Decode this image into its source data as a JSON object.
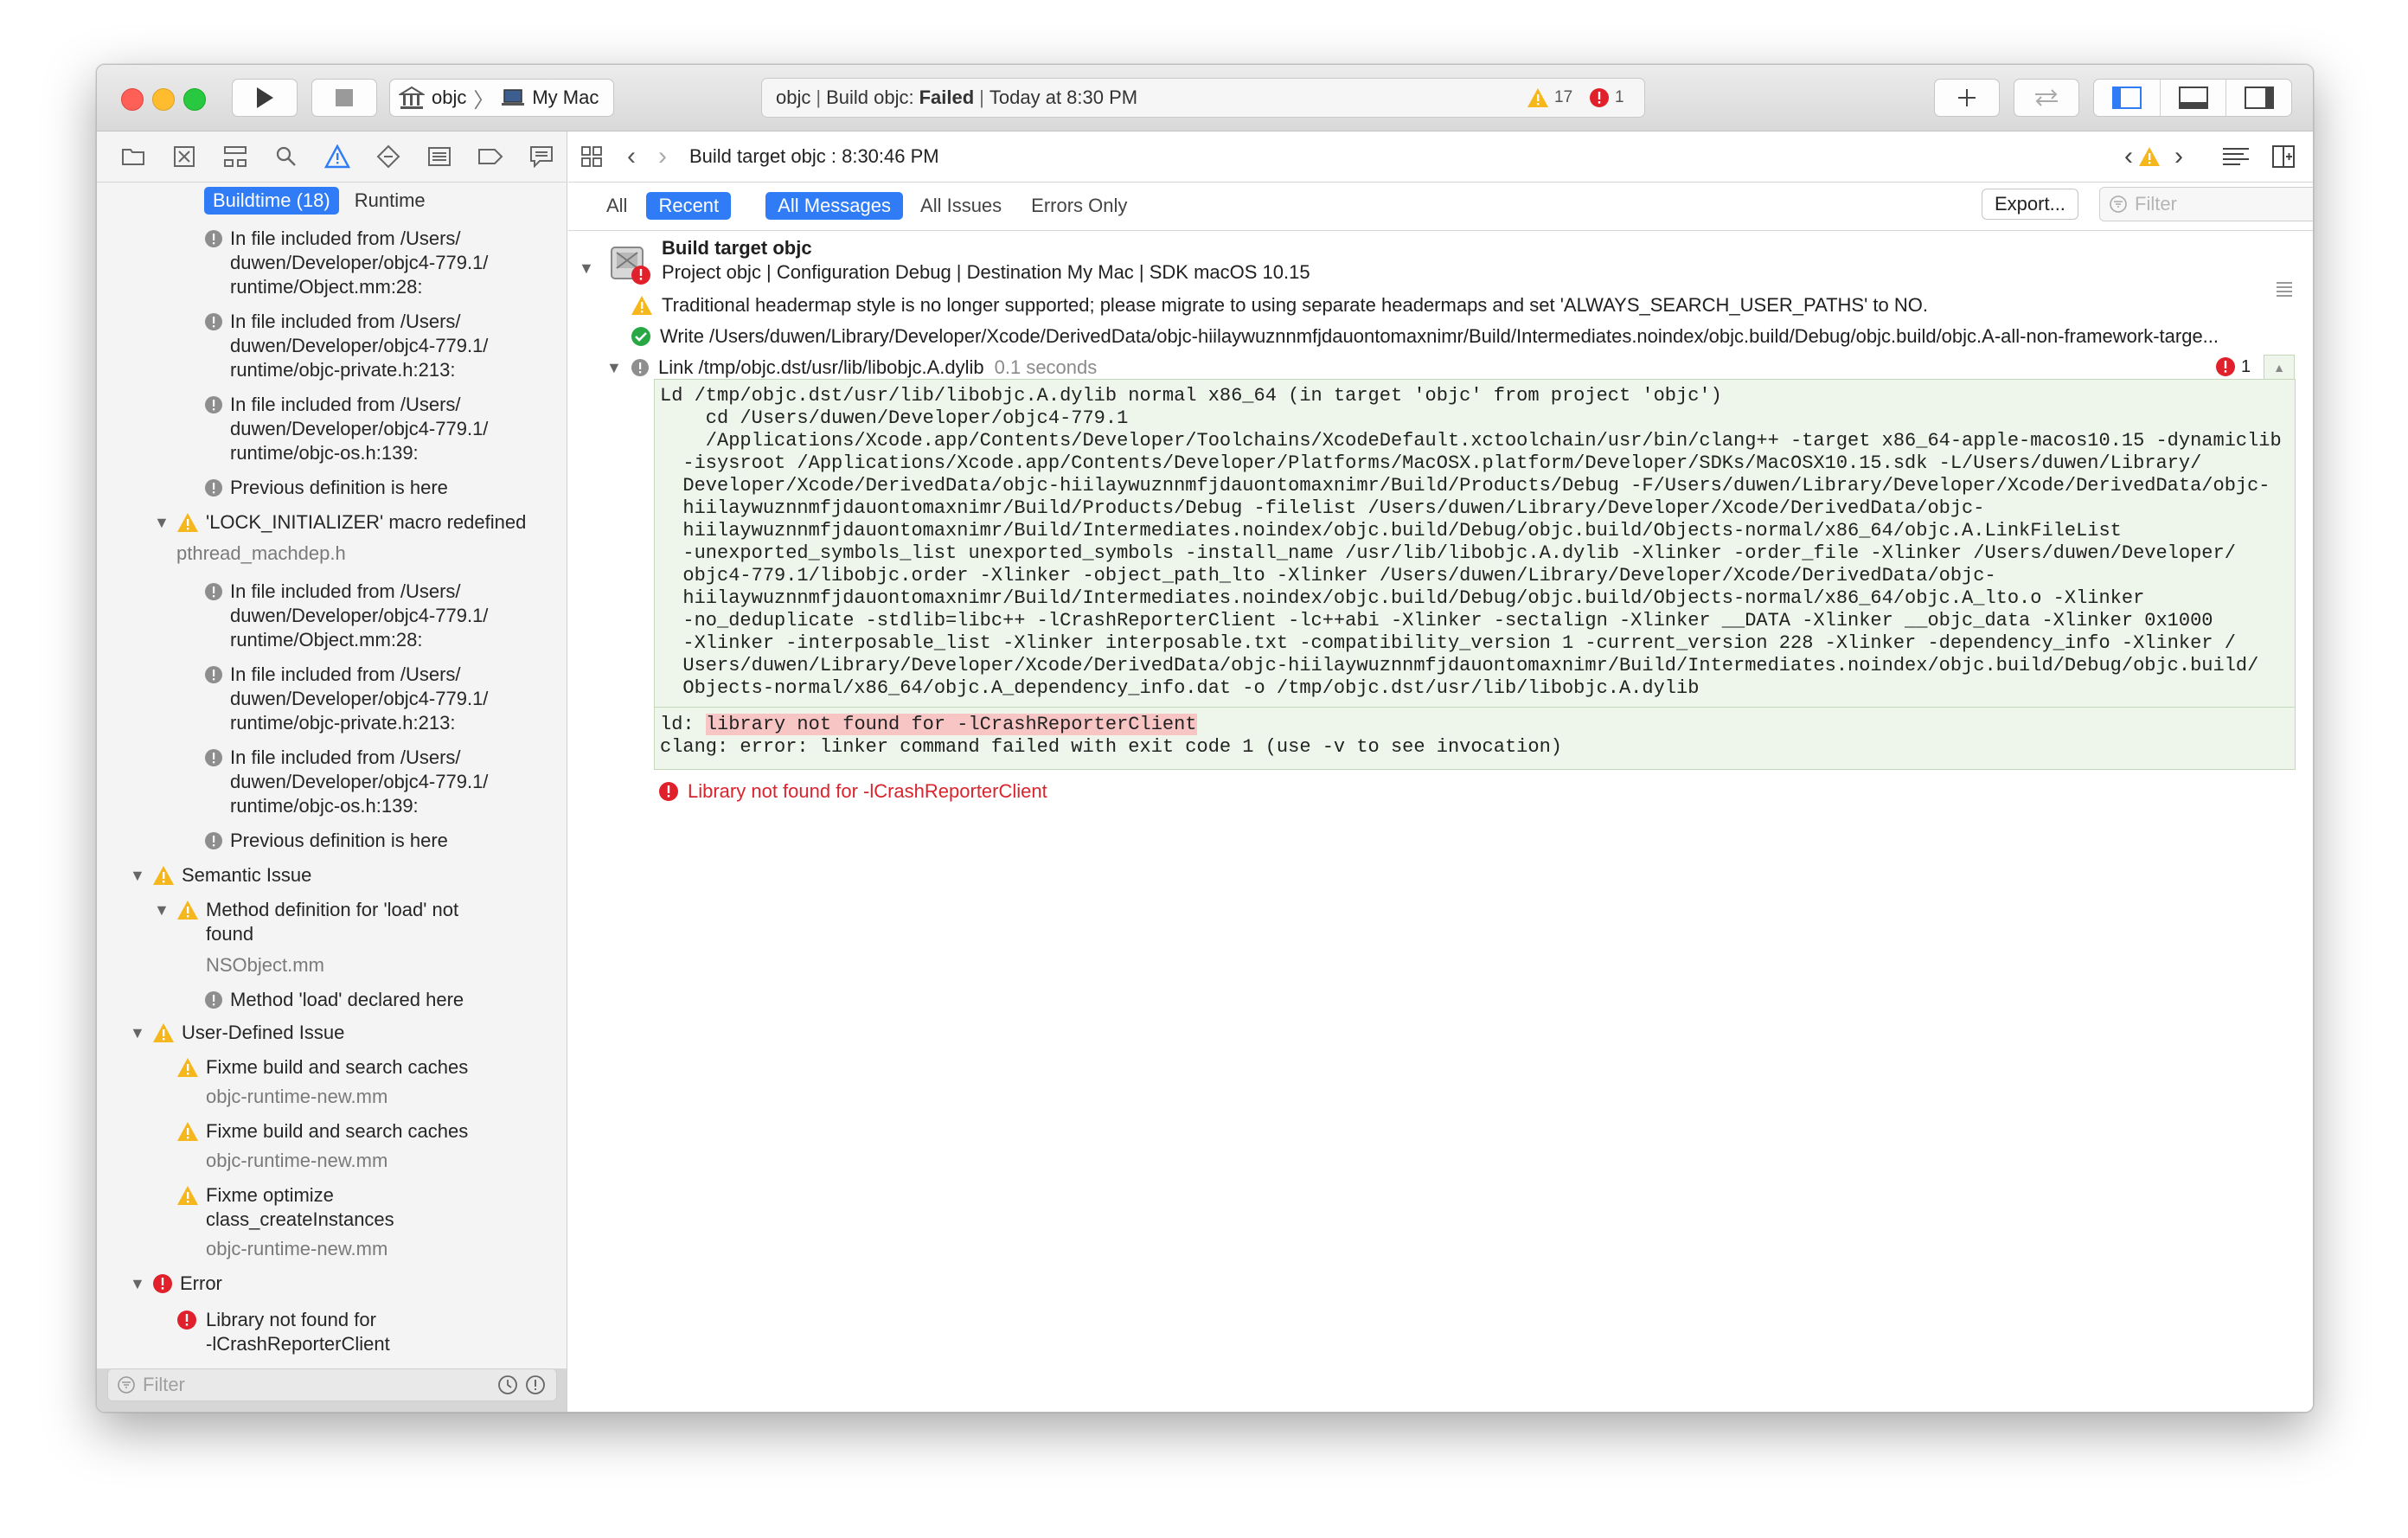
{
  "toolbar": {
    "scheme_name": "objc",
    "destination": "My Mac",
    "activity_project": "objc",
    "activity_action": "Build objc:",
    "activity_status": "Failed",
    "activity_time": "Today at 8:30 PM",
    "warning_count": "17",
    "error_count": "1",
    "colors": {
      "warning": "#f5b71b",
      "error": "#e0202b"
    }
  },
  "navigator": {
    "scope_tabs": [
      "Buildtime (18)",
      "Runtime"
    ],
    "rows": [
      {
        "type": "note",
        "text": "In file included from /Users/\nduwen/Developer/objc4-779.1/\nruntime/Object.mm:28:"
      },
      {
        "type": "note",
        "text": "In file included from /Users/\nduwen/Developer/objc4-779.1/\nruntime/objc-private.h:213:"
      },
      {
        "type": "note",
        "text": "In file included from /Users/\nduwen/Developer/objc4-779.1/\nruntime/objc-os.h:139:"
      },
      {
        "type": "note",
        "text": "Previous definition is here"
      },
      {
        "type": "warning",
        "text": "'LOCK_INITIALIZER' macro redefined",
        "sub": "pthread_machdep.h"
      },
      {
        "type": "note",
        "text": "In file included from /Users/\nduwen/Developer/objc4-779.1/\nruntime/Object.mm:28:"
      },
      {
        "type": "note",
        "text": "In file included from /Users/\nduwen/Developer/objc4-779.1/\nruntime/objc-private.h:213:"
      },
      {
        "type": "note",
        "text": "In file included from /Users/\nduwen/Developer/objc4-779.1/\nruntime/objc-os.h:139:"
      },
      {
        "type": "note",
        "text": "Previous definition is here"
      },
      {
        "type": "group-warning",
        "text": "Semantic Issue"
      },
      {
        "type": "warning",
        "text": "Method definition for 'load' not\nfound",
        "sub": "NSObject.mm"
      },
      {
        "type": "note",
        "text": "Method 'load' declared here"
      },
      {
        "type": "group-warning",
        "text": "User-Defined Issue"
      },
      {
        "type": "warning",
        "text": "Fixme build and search caches",
        "sub": "objc-runtime-new.mm"
      },
      {
        "type": "warning",
        "text": "Fixme build and search caches",
        "sub": "objc-runtime-new.mm"
      },
      {
        "type": "warning",
        "text": "Fixme optimize\nclass_createInstances",
        "sub": "objc-runtime-new.mm"
      },
      {
        "type": "group-error",
        "text": "Error"
      },
      {
        "type": "error",
        "text": "Library not found for\n-lCrashReporterClient"
      }
    ],
    "filter_placeholder": "Filter"
  },
  "editor": {
    "jump_title": "Build target objc : 8:30:46 PM",
    "filters": [
      "All",
      "Recent",
      "All Messages",
      "All Issues",
      "Errors Only"
    ],
    "export_label": "Export...",
    "filter_placeholder": "Filter",
    "target_title": "Build target objc",
    "target_meta": "Project objc | Configuration Debug | Destination My Mac | SDK macOS 10.15",
    "warning_line": "Traditional headermap style is no longer supported; please migrate to using separate headermaps and set 'ALWAYS_SEARCH_USER_PATHS' to NO.",
    "write_line": "Write /Users/duwen/Library/Developer/Xcode/DerivedData/objc-hiilaywuznnmfjdauontomaxnimr/Build/Intermediates.noindex/objc.build/Debug/objc.build/objc.A-all-non-framework-targe...",
    "link_line": "Link /tmp/objc.dst/usr/lib/libobjc.A.dylib",
    "link_duration": "0.1 seconds",
    "link_error_count": "1",
    "command_lines": [
      "Ld /tmp/objc.dst/usr/lib/libobjc.A.dylib normal x86_64 (in target 'objc' from project 'objc')",
      "    cd /Users/duwen/Developer/objc4-779.1",
      "    /Applications/Xcode.app/Contents/Developer/Toolchains/XcodeDefault.xctoolchain/usr/bin/clang++ -target x86_64-apple-macos10.15 -dynamiclib",
      "  -isysroot /Applications/Xcode.app/Contents/Developer/Platforms/MacOSX.platform/Developer/SDKs/MacOSX10.15.sdk -L/Users/duwen/Library/",
      "  Developer/Xcode/DerivedData/objc-hiilaywuznnmfjdauontomaxnimr/Build/Products/Debug -F/Users/duwen/Library/Developer/Xcode/DerivedData/objc-",
      "  hiilaywuznnmfjdauontomaxnimr/Build/Products/Debug -filelist /Users/duwen/Library/Developer/Xcode/DerivedData/objc-",
      "  hiilaywuznnmfjdauontomaxnimr/Build/Intermediates.noindex/objc.build/Debug/objc.build/Objects-normal/x86_64/objc.A.LinkFileList",
      "  -unexported_symbols_list unexported_symbols -install_name /usr/lib/libobjc.A.dylib -Xlinker -order_file -Xlinker /Users/duwen/Developer/",
      "  objc4-779.1/libobjc.order -Xlinker -object_path_lto -Xlinker /Users/duwen/Library/Developer/Xcode/DerivedData/objc-",
      "  hiilaywuznnmfjdauontomaxnimr/Build/Intermediates.noindex/objc.build/Debug/objc.build/Objects-normal/x86_64/objc.A_lto.o -Xlinker",
      "  -no_deduplicate -stdlib=libc++ -lCrashReporterClient -lc++abi -Xlinker -sectalign -Xlinker __DATA -Xlinker __objc_data -Xlinker 0x1000",
      "  -Xlinker -interposable_list -Xlinker interposable.txt -compatibility_version 1 -current_version 228 -Xlinker -dependency_info -Xlinker /",
      "  Users/duwen/Library/Developer/Xcode/DerivedData/objc-hiilaywuznnmfjdauontomaxnimr/Build/Intermediates.noindex/objc.build/Debug/objc.build/",
      "  Objects-normal/x86_64/objc.A_dependency_info.dat -o /tmp/objc.dst/usr/lib/libobjc.A.dylib"
    ],
    "ld_prefix": "ld: ",
    "ld_error": "library not found for -lCrashReporterClient",
    "clang_error": "clang: error: linker command failed with exit code 1 (use -v to see invocation)",
    "result_error": "Library not found for -lCrashReporterClient"
  }
}
